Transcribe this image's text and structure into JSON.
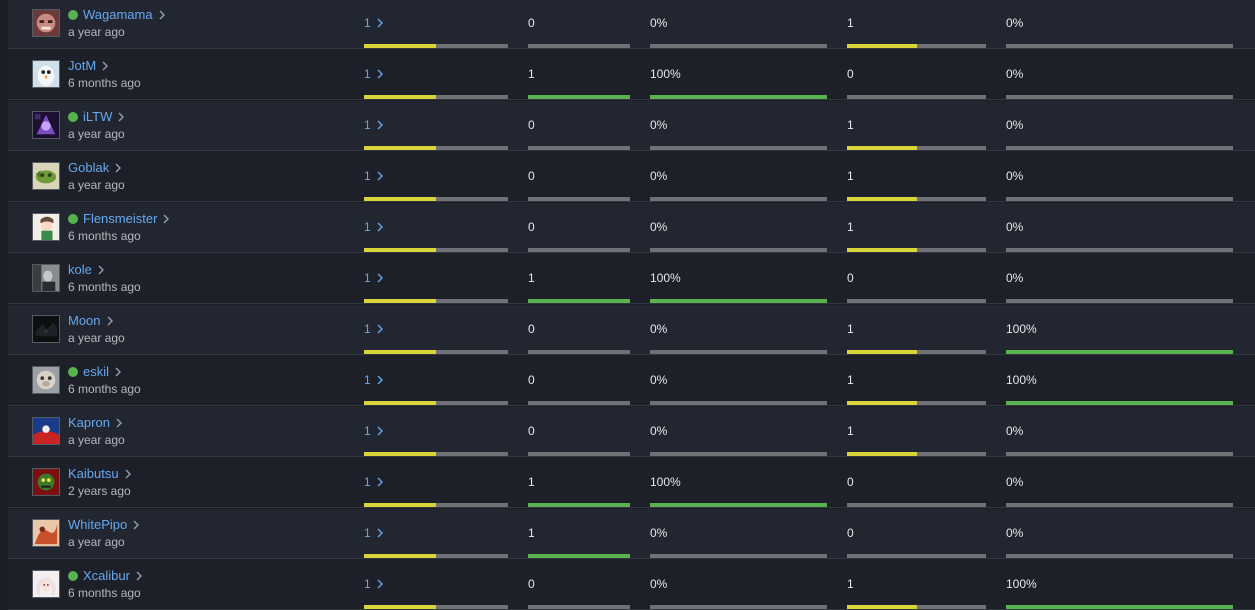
{
  "colors": {
    "link": "#66a8f0",
    "online": "#58b24f",
    "bar_track": "#6f7176",
    "bar_yellow": "#d9d438",
    "bar_green": "#58b24f"
  },
  "rows": [
    {
      "name": "Wagamama",
      "online": true,
      "time": "a year ago",
      "avatar": "avatar-face-pink",
      "c1": "1",
      "c1_fill": 0.5,
      "c2": "0",
      "c2_fill": 0,
      "c3": "0%",
      "c3_fill": 0,
      "c4": "1",
      "c4_fill": 0.5,
      "c5": "0%",
      "c5_fill": 0
    },
    {
      "name": "JotM",
      "online": false,
      "time": "6 months ago",
      "avatar": "avatar-penguin",
      "c1": "1",
      "c1_fill": 0.5,
      "c2": "1",
      "c2_fill": 1,
      "c3": "100%",
      "c3_fill": 1,
      "c4": "0",
      "c4_fill": 0,
      "c5": "0%",
      "c5_fill": 0
    },
    {
      "name": "iLTW",
      "online": true,
      "time": "a year ago",
      "avatar": "avatar-purple-art",
      "c1": "1",
      "c1_fill": 0.5,
      "c2": "0",
      "c2_fill": 0,
      "c3": "0%",
      "c3_fill": 0,
      "c4": "1",
      "c4_fill": 0.5,
      "c5": "0%",
      "c5_fill": 0
    },
    {
      "name": "Goblak",
      "online": false,
      "time": "a year ago",
      "avatar": "avatar-green-creature",
      "c1": "1",
      "c1_fill": 0.5,
      "c2": "0",
      "c2_fill": 0,
      "c3": "0%",
      "c3_fill": 0,
      "c4": "1",
      "c4_fill": 0.5,
      "c5": "0%",
      "c5_fill": 0
    },
    {
      "name": "Flensmeister",
      "online": true,
      "time": "6 months ago",
      "avatar": "avatar-anime-girl",
      "c1": "1",
      "c1_fill": 0.5,
      "c2": "0",
      "c2_fill": 0,
      "c3": "0%",
      "c3_fill": 0,
      "c4": "1",
      "c4_fill": 0.5,
      "c5": "0%",
      "c5_fill": 0
    },
    {
      "name": "kole",
      "online": false,
      "time": "6 months ago",
      "avatar": "avatar-grey-figure",
      "c1": "1",
      "c1_fill": 0.5,
      "c2": "1",
      "c2_fill": 1,
      "c3": "100%",
      "c3_fill": 1,
      "c4": "0",
      "c4_fill": 0,
      "c5": "0%",
      "c5_fill": 0
    },
    {
      "name": "Moon",
      "online": false,
      "time": "a year ago",
      "avatar": "avatar-dark",
      "c1": "1",
      "c1_fill": 0.5,
      "c2": "0",
      "c2_fill": 0,
      "c3": "0%",
      "c3_fill": 0,
      "c4": "1",
      "c4_fill": 0.5,
      "c5": "100%",
      "c5_fill": 1
    },
    {
      "name": "eskil",
      "online": true,
      "time": "6 months ago",
      "avatar": "avatar-monkey",
      "c1": "1",
      "c1_fill": 0.5,
      "c2": "0",
      "c2_fill": 0,
      "c3": "0%",
      "c3_fill": 0,
      "c4": "1",
      "c4_fill": 0.5,
      "c5": "100%",
      "c5_fill": 1
    },
    {
      "name": "Kapron",
      "online": false,
      "time": "a year ago",
      "avatar": "avatar-blue-red",
      "c1": "1",
      "c1_fill": 0.5,
      "c2": "0",
      "c2_fill": 0,
      "c3": "0%",
      "c3_fill": 0,
      "c4": "1",
      "c4_fill": 0.5,
      "c5": "0%",
      "c5_fill": 0
    },
    {
      "name": "Kaibutsu",
      "online": false,
      "time": "2 years ago",
      "avatar": "avatar-red-green",
      "c1": "1",
      "c1_fill": 0.5,
      "c2": "1",
      "c2_fill": 1,
      "c3": "100%",
      "c3_fill": 1,
      "c4": "0",
      "c4_fill": 0,
      "c5": "0%",
      "c5_fill": 0
    },
    {
      "name": "WhitePipo",
      "online": false,
      "time": "a year ago",
      "avatar": "avatar-orange-art",
      "c1": "1",
      "c1_fill": 0.5,
      "c2": "1",
      "c2_fill": 1,
      "c3": "0%",
      "c3_fill": 0,
      "c4": "0",
      "c4_fill": 0,
      "c5": "0%",
      "c5_fill": 0
    },
    {
      "name": "Xcalibur",
      "online": true,
      "time": "6 months ago",
      "avatar": "avatar-anime-white-hair",
      "c1": "1",
      "c1_fill": 0.5,
      "c2": "0",
      "c2_fill": 0,
      "c3": "0%",
      "c3_fill": 0,
      "c4": "1",
      "c4_fill": 0.5,
      "c5": "100%",
      "c5_fill": 1
    }
  ]
}
